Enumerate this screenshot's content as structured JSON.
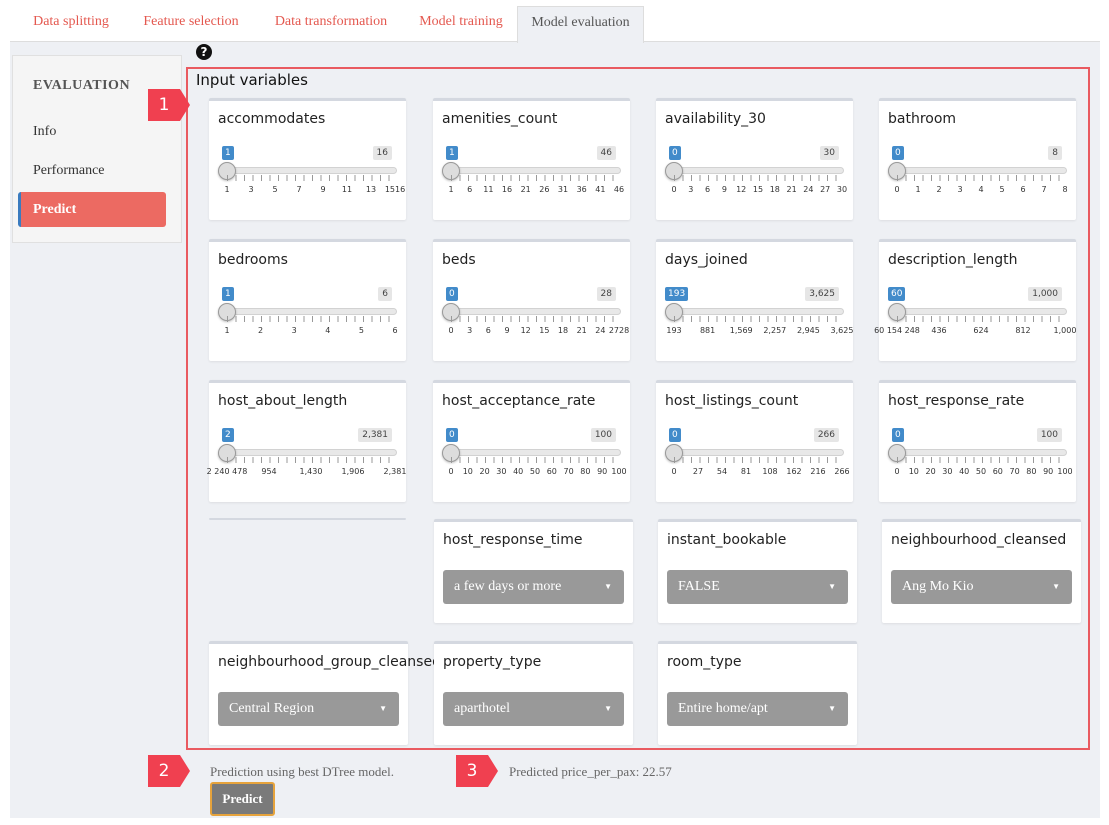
{
  "tabs": [
    "Data splitting",
    "Feature selection",
    "Data transformation",
    "Model training",
    "Model evaluation"
  ],
  "sidebar": {
    "title": "EVALUATION",
    "items": [
      "Info",
      "Performance",
      "Predict"
    ]
  },
  "panel_title": "Input variables",
  "sliders": [
    {
      "label": "accommodates",
      "value": "1",
      "max": "16",
      "ticks": [
        "1",
        "3",
        "5",
        "7",
        "9",
        "11",
        "13",
        "1516"
      ]
    },
    {
      "label": "amenities_count",
      "value": "1",
      "max": "46",
      "ticks": [
        "1",
        "6",
        "11",
        "16",
        "21",
        "26",
        "31",
        "36",
        "41",
        "46"
      ]
    },
    {
      "label": "availability_30",
      "value": "0",
      "max": "30",
      "ticks": [
        "0",
        "3",
        "6",
        "9",
        "12",
        "15",
        "18",
        "21",
        "24",
        "27",
        "30"
      ]
    },
    {
      "label": "bathroom",
      "value": "0",
      "max": "8",
      "ticks": [
        "0",
        "1",
        "2",
        "3",
        "4",
        "5",
        "6",
        "7",
        "8"
      ]
    },
    {
      "label": "bedrooms",
      "value": "1",
      "max": "6",
      "ticks": [
        "1",
        "2",
        "3",
        "4",
        "5",
        "6"
      ]
    },
    {
      "label": "beds",
      "value": "0",
      "max": "28",
      "ticks": [
        "0",
        "3",
        "6",
        "9",
        "12",
        "15",
        "18",
        "21",
        "24",
        "2728"
      ]
    },
    {
      "label": "days_joined",
      "value": "193",
      "max": "3,625",
      "ticks": [
        "193",
        "881",
        "1,569",
        "2,257",
        "2,945",
        "3,625"
      ]
    },
    {
      "label": "description_length",
      "value": "60",
      "max": "1,000",
      "ticks": [
        "60 154 248",
        "436",
        "624",
        "812",
        "1,000"
      ]
    },
    {
      "label": "host_about_length",
      "value": "2",
      "max": "2,381",
      "ticks": [
        "2 240 478",
        "954",
        "1,430",
        "1,906",
        "2,381"
      ]
    },
    {
      "label": "host_acceptance_rate",
      "value": "0",
      "max": "100",
      "ticks": [
        "0",
        "10",
        "20",
        "30",
        "40",
        "50",
        "60",
        "70",
        "80",
        "90",
        "100"
      ]
    },
    {
      "label": "host_listings_count",
      "value": "0",
      "max": "266",
      "ticks": [
        "0",
        "27",
        "54",
        "81",
        "108",
        "162",
        "216",
        "266"
      ]
    },
    {
      "label": "host_response_rate",
      "value": "0",
      "max": "100",
      "ticks": [
        "0",
        "10",
        "20",
        "30",
        "40",
        "50",
        "60",
        "70",
        "80",
        "90",
        "100"
      ]
    }
  ],
  "selects": [
    {
      "label": "host_response_time",
      "value": "a few days or more"
    },
    {
      "label": "instant_bookable",
      "value": "FALSE"
    },
    {
      "label": "neighbourhood_cleansed",
      "value": "Ang Mo Kio"
    },
    {
      "label": "neighbourhood_group_cleansed",
      "value": "Central Region"
    },
    {
      "label": "property_type",
      "value": "aparthotel"
    },
    {
      "label": "room_type",
      "value": "Entire home/apt"
    }
  ],
  "markers": [
    "1",
    "2",
    "3"
  ],
  "footer": {
    "model_text": "Prediction using best DTree model.",
    "button": "Predict",
    "result": "Predicted price_per_pax: 22.57"
  },
  "colors": {
    "accent": "#e4584f",
    "badge": "#428bca",
    "select_bg": "#999999",
    "marker": "#f04050"
  }
}
